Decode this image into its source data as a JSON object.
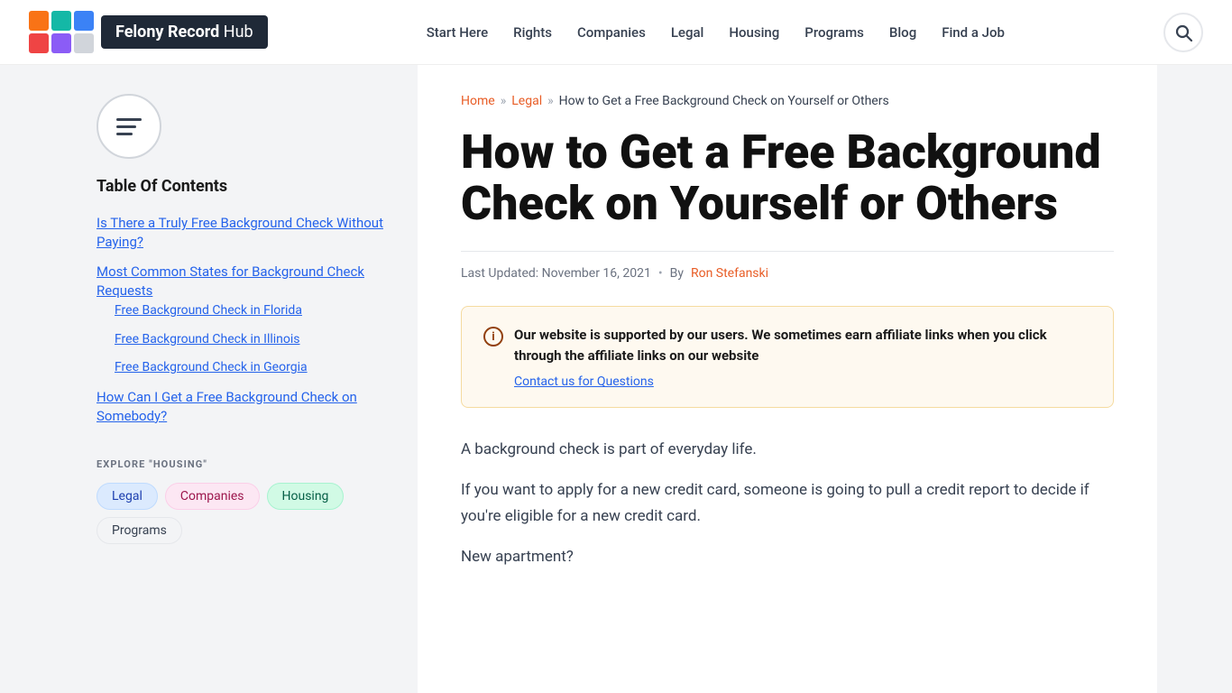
{
  "header": {
    "logo_brand": "Felony Record",
    "logo_suffix": " Hub",
    "nav_items": [
      "Start Here",
      "Rights",
      "Companies",
      "Legal",
      "Housing",
      "Programs",
      "Blog",
      "Find a Job"
    ]
  },
  "sidebar": {
    "toc_title": "Table Of Contents",
    "toc_items": [
      {
        "label": "Is There a Truly Free Background Check Without Paying?",
        "href": "#free-check",
        "sub": []
      },
      {
        "label": "Most Common States for Background Check Requests",
        "href": "#common-states",
        "sub": [
          {
            "label": "Free Background Check in Florida",
            "href": "#florida"
          },
          {
            "label": "Free Background Check in Illinois",
            "href": "#illinois"
          },
          {
            "label": "Free Background Check in Georgia",
            "href": "#georgia"
          }
        ]
      },
      {
        "label": "How Can I Get a Free Background Check on Somebody?",
        "href": "#somebody",
        "sub": []
      }
    ],
    "explore_label": "EXPLORE \"HOUSING\"",
    "tags": [
      {
        "label": "Legal",
        "style": "legal"
      },
      {
        "label": "Companies",
        "style": "companies"
      },
      {
        "label": "Housing",
        "style": "housing"
      },
      {
        "label": "Programs",
        "style": "programs"
      }
    ]
  },
  "article": {
    "breadcrumb_home": "Home",
    "breadcrumb_legal": "Legal",
    "breadcrumb_current": "How to Get a Free Background Check on Yourself or Others",
    "title": "How to Get a Free Background Check on Yourself or Others",
    "meta_updated": "Last Updated: November 16, 2021",
    "meta_by": "By",
    "meta_author": "Ron Stefanski",
    "affiliate_text": "Our website is supported by our users. We sometimes earn affiliate links when you click through the affiliate links on our website",
    "affiliate_link": "Contact us for Questions",
    "body_p1": "A background check is part of everyday life.",
    "body_p2": "If you want to apply for a new credit card, someone is going to pull a credit report to decide if you're eligible for a new credit card.",
    "body_p3": "New apartment?"
  }
}
